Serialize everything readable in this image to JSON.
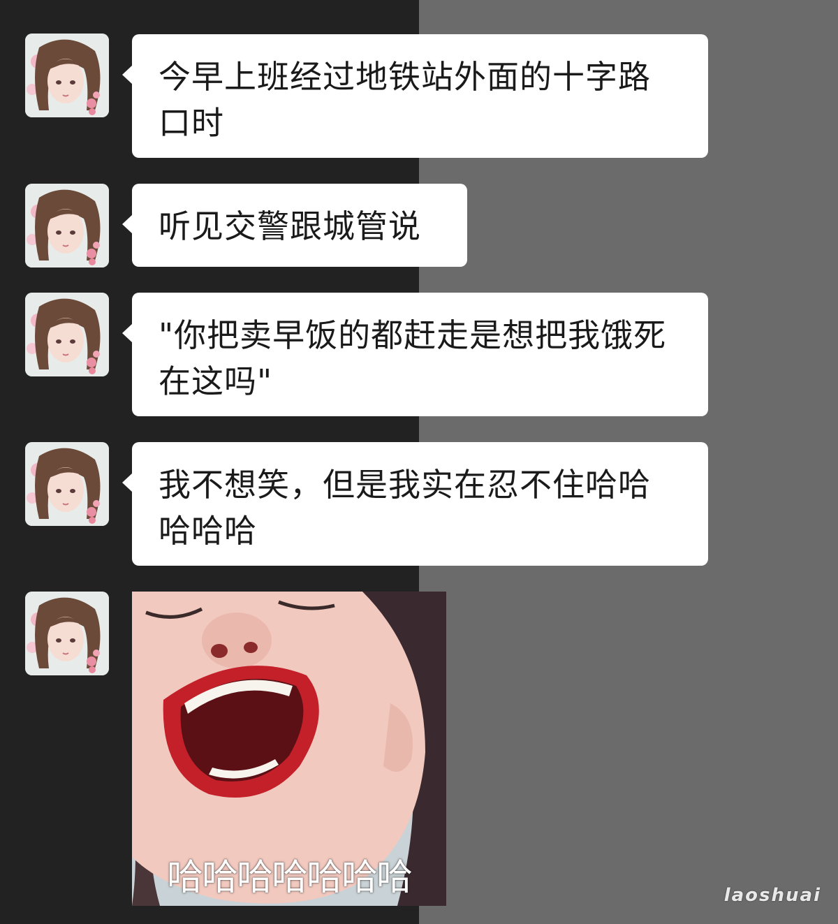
{
  "colors": {
    "left_background": "#222222",
    "right_background": "#6b6b6b",
    "bubble": "#ffffff",
    "text": "#1a1a1a"
  },
  "messages": [
    {
      "sender": "avatar-girl",
      "text": "今早上班经过地铁站外面的十字路口时"
    },
    {
      "sender": "avatar-girl",
      "text": "听见交警跟城管说"
    },
    {
      "sender": "avatar-girl",
      "text": "\"你把卖早饭的都赶走是想把我饿死在这吗\""
    },
    {
      "sender": "avatar-girl",
      "text": "我不想笑，但是我实在忍不住哈哈哈哈哈"
    }
  ],
  "sticker": {
    "caption": "哈哈哈哈哈哈哈"
  },
  "watermark": "laoshuai"
}
